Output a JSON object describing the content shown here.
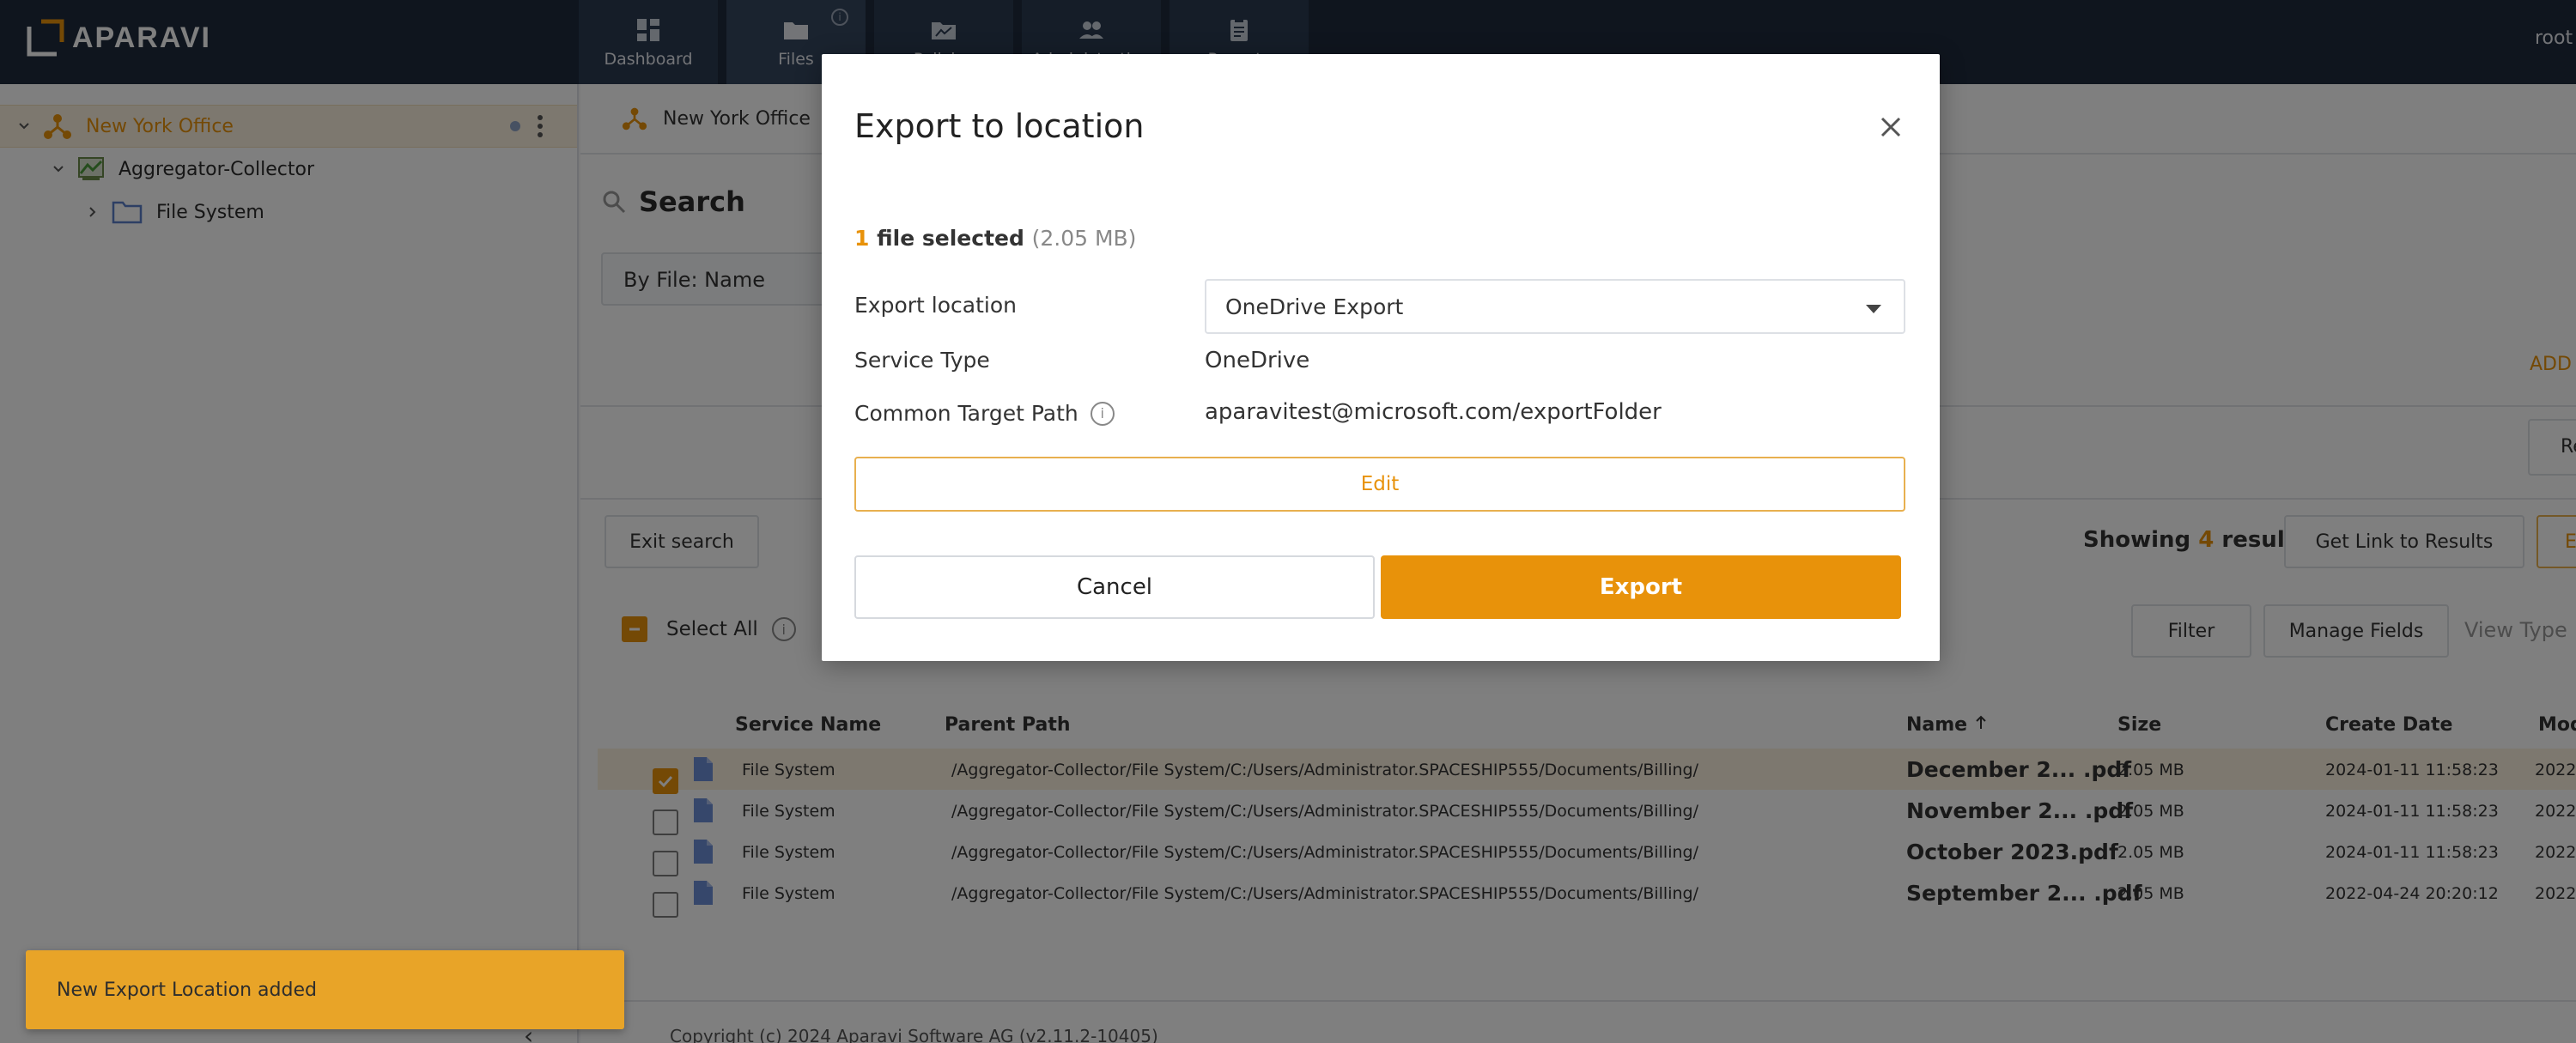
{
  "app": {
    "logo_text": "APARAVI",
    "user": "root"
  },
  "nav": [
    {
      "label": "Dashboard",
      "icon": "dashboard-icon"
    },
    {
      "label": "Files",
      "icon": "folder-icon"
    },
    {
      "label": "Policies",
      "icon": "policies-icon"
    },
    {
      "label": "Administration",
      "icon": "users-icon"
    },
    {
      "label": "Reports",
      "icon": "clipboard-icon"
    }
  ],
  "sidebar": {
    "items": [
      {
        "label": "New York Office",
        "icon": "network-node-icon"
      },
      {
        "label": "Aggregator-Collector",
        "icon": "aggregator-icon"
      },
      {
        "label": "File System",
        "icon": "folder-icon"
      }
    ]
  },
  "breadcrumb": {
    "label": "New York Office"
  },
  "search": {
    "title": "Search",
    "field": "By File: Name",
    "add_label": "ADD",
    "right_button": "Re"
  },
  "toolbar": {
    "exit_search": "Exit search",
    "showing_prefix": "Showing",
    "showing_count": "4",
    "showing_suffix": "results",
    "get_link": "Get Link to Results",
    "right_cut": "E",
    "select_all": "Select All",
    "filter": "Filter",
    "manage_fields": "Manage Fields",
    "view_type": "View Type"
  },
  "table": {
    "headers": {
      "service": "Service Name",
      "parent": "Parent Path",
      "name": "Name",
      "size": "Size",
      "create": "Create Date",
      "modified": "Mod"
    },
    "rows": [
      {
        "service": "File System",
        "parent": "/Aggregator-Collector/File System/C:/Users/Administrator.SPACESHIP555/Documents/Billing/",
        "name": "December 2... .pdf",
        "size": "2.05 MB",
        "create": "2024-01-11 11:58:23",
        "modified": "2022-",
        "checked": true
      },
      {
        "service": "File System",
        "parent": "/Aggregator-Collector/File System/C:/Users/Administrator.SPACESHIP555/Documents/Billing/",
        "name": "November 2... .pdf",
        "size": "2.05 MB",
        "create": "2024-01-11 11:58:23",
        "modified": "2022-",
        "checked": false
      },
      {
        "service": "File System",
        "parent": "/Aggregator-Collector/File System/C:/Users/Administrator.SPACESHIP555/Documents/Billing/",
        "name": "October 2023.pdf",
        "size": "2.05 MB",
        "create": "2024-01-11 11:58:23",
        "modified": "2022-",
        "checked": false
      },
      {
        "service": "File System",
        "parent": "/Aggregator-Collector/File System/C:/Users/Administrator.SPACESHIP555/Documents/Billing/",
        "name": "September 2... .pdf",
        "size": "2.05 MB",
        "create": "2022-04-24 20:20:12",
        "modified": "2022-",
        "checked": false
      }
    ]
  },
  "footer": {
    "text": "Copyright (c) 2024 Aparavi Software AG (v2.11.2-10405)"
  },
  "modal": {
    "title": "Export to location",
    "selected_count": "1",
    "selected_label": "file selected",
    "selected_size": "(2.05 MB)",
    "export_location_label": "Export location",
    "export_location_value": "OneDrive Export",
    "service_type_label": "Service Type",
    "service_type_value": "OneDrive",
    "target_path_label": "Common Target Path",
    "target_path_value": "aparavitest@microsoft.com/exportFolder",
    "edit_label": "Edit",
    "cancel_label": "Cancel",
    "export_label": "Export"
  },
  "toast": {
    "message": "New Export Location added"
  },
  "colors": {
    "accent": "#e8920a",
    "topbar": "#1f2b3d",
    "selected_row": "#fbf0df",
    "toast": "#e8a428"
  }
}
